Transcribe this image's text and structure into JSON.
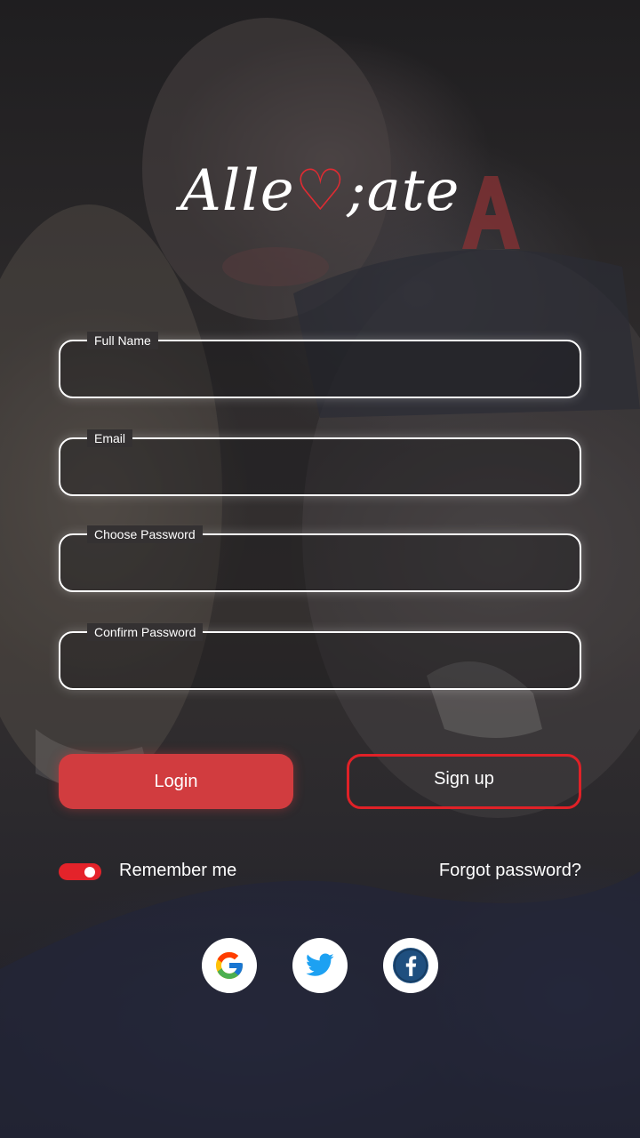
{
  "app": {
    "logo_text_before": "Alle",
    "logo_heart": "♡",
    "logo_text_after": ";ate"
  },
  "form": {
    "fields": [
      {
        "label": "Full Name",
        "value": "",
        "type": "text"
      },
      {
        "label": "Email",
        "value": "",
        "type": "email"
      },
      {
        "label": "Choose Password",
        "value": "",
        "type": "password"
      },
      {
        "label": "Confirm Password",
        "value": "",
        "type": "password"
      }
    ]
  },
  "actions": {
    "login_label": "Login",
    "signup_label": "Sign up"
  },
  "options": {
    "remember_label": "Remember me",
    "remember_on": true,
    "forgot_label": "Forgot password?"
  },
  "social": {
    "providers": [
      "google-icon",
      "twitter-icon",
      "facebook-icon"
    ]
  },
  "colors": {
    "accent": "#e02127",
    "login_fill": "#d13c3f",
    "field_border": "#ffffff"
  }
}
